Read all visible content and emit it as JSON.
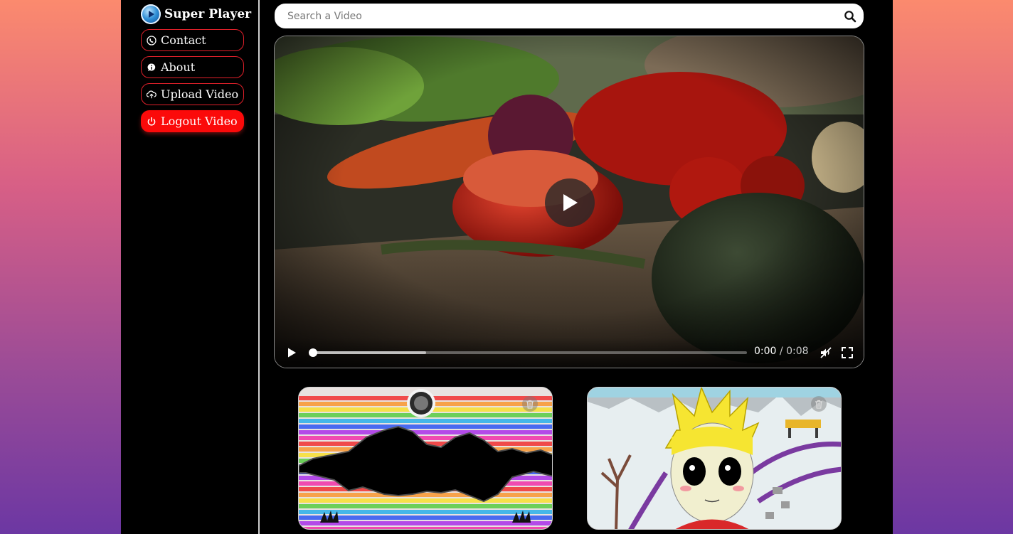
{
  "brand": {
    "title": "Super Player",
    "logo_icon": "play-circle-icon"
  },
  "nav": {
    "items": [
      {
        "label": "Contact",
        "icon": "phone-icon"
      },
      {
        "label": "About",
        "icon": "info-bubble-icon"
      },
      {
        "label": "Upload Video",
        "icon": "cloud-upload-icon"
      },
      {
        "label": "Logout Video",
        "icon": "power-icon"
      }
    ]
  },
  "search": {
    "placeholder": "Search a Video",
    "value": "",
    "icon": "search-icon"
  },
  "player": {
    "current_time": "0:00",
    "separator": "/",
    "duration": "0:08",
    "progress": 0,
    "buffered": 0.26
  },
  "videos": [
    {
      "thumbnail": "rainbow-stripes-landscape",
      "delete_icon": "trash-icon"
    },
    {
      "thumbnail": "cartoon-boy-winter",
      "delete_icon": "trash-icon"
    }
  ],
  "colors": {
    "accent": "#fb0a0a",
    "background_top": "#fb8a6e",
    "background_bottom": "#6c37a3"
  }
}
